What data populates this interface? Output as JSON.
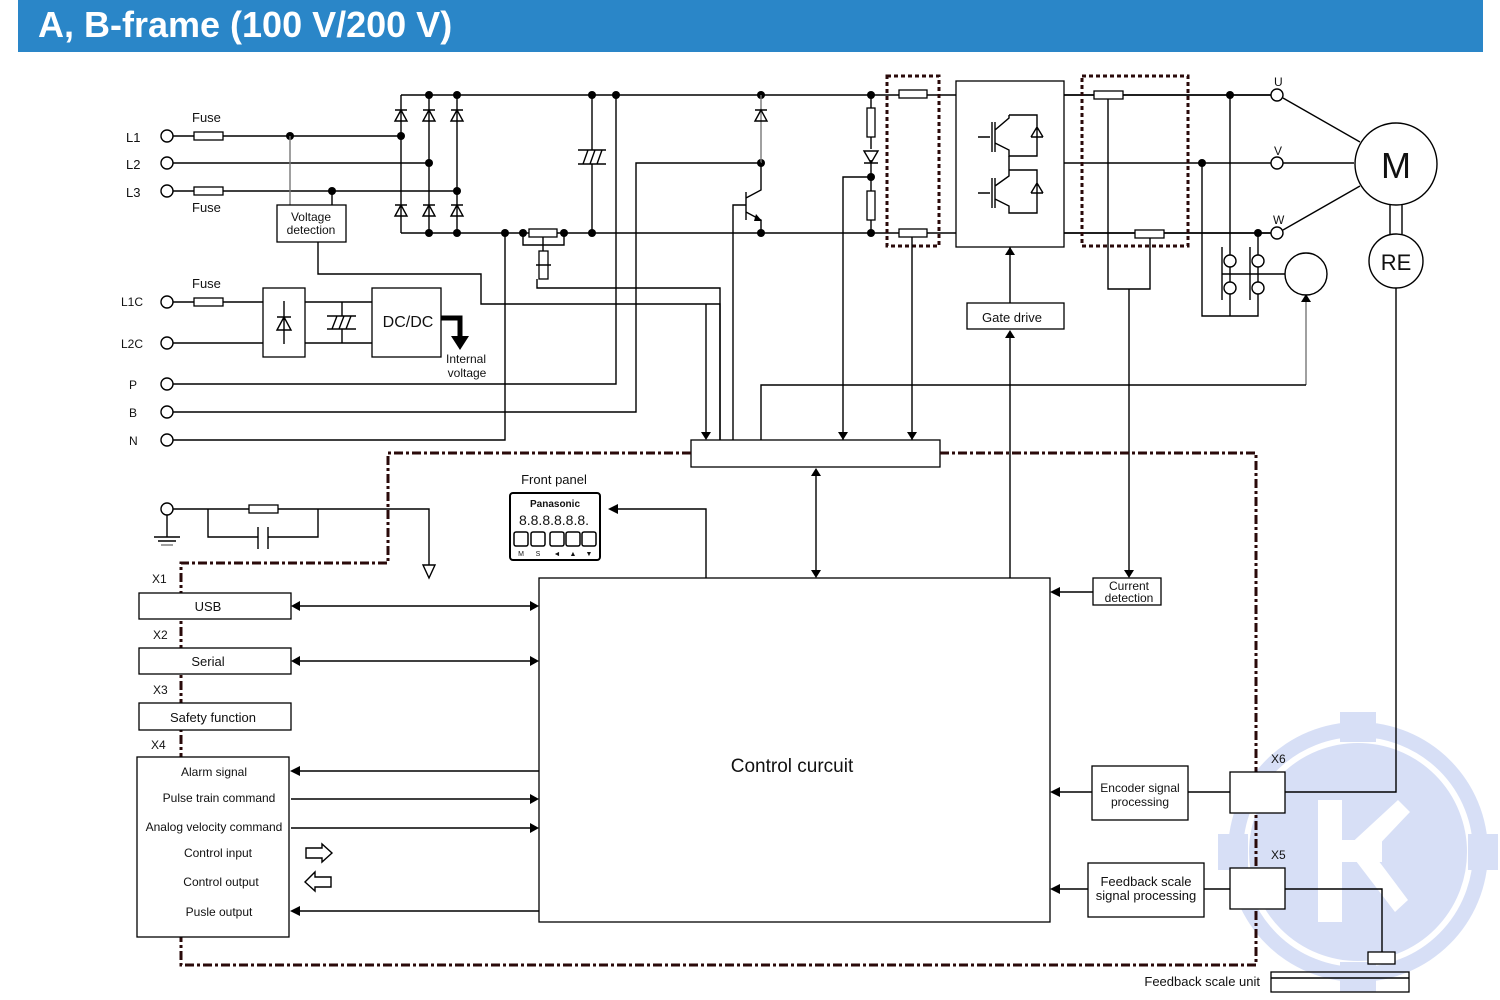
{
  "header": {
    "title": "A, B-frame (100 V/200 V)",
    "background": "#2a86c8"
  },
  "power_input": {
    "terminals": [
      "L1",
      "L2",
      "L3"
    ],
    "fuse_label_top": "Fuse",
    "fuse_label_bottom": "Fuse",
    "voltage_detection": [
      "Voltage",
      "detection"
    ]
  },
  "control_power": {
    "terminals": [
      "L1C",
      "L2C"
    ],
    "fuse_label": "Fuse",
    "dcdc_label": "DC/DC",
    "internal_voltage": [
      "Internal",
      "voltage"
    ]
  },
  "regen_terminals": [
    "P",
    "B",
    "N"
  ],
  "output": {
    "terminals": [
      "U",
      "V",
      "W"
    ],
    "motor_label": "M",
    "encoder_label": "RE",
    "gate_drive": "Gate drive"
  },
  "front_panel": {
    "label": "Front panel",
    "brand": "Panasonic",
    "display": "8.8.8.8.8.8.",
    "keys": [
      "M",
      "S",
      "◄",
      "▲",
      "▼"
    ]
  },
  "connectors": {
    "x1": {
      "id": "X1",
      "label": "USB"
    },
    "x2": {
      "id": "X2",
      "label": "Serial"
    },
    "x3": {
      "id": "X3",
      "label": "Safety function"
    },
    "x4": {
      "id": "X4",
      "signals": [
        "Alarm signal",
        "Pulse train command",
        "Analog velocity command",
        "Control input",
        "Control output",
        "Pusle output"
      ]
    },
    "x5": {
      "id": "X5"
    },
    "x6": {
      "id": "X6"
    }
  },
  "blocks": {
    "control_circuit": "Control curcuit",
    "current_detection": [
      "Current",
      "detection"
    ],
    "encoder_processing": [
      "Encoder signal",
      "processing"
    ],
    "feedback_processing": [
      "Feedback scale",
      "signal processing"
    ],
    "feedback_unit": "Feedback scale unit"
  }
}
